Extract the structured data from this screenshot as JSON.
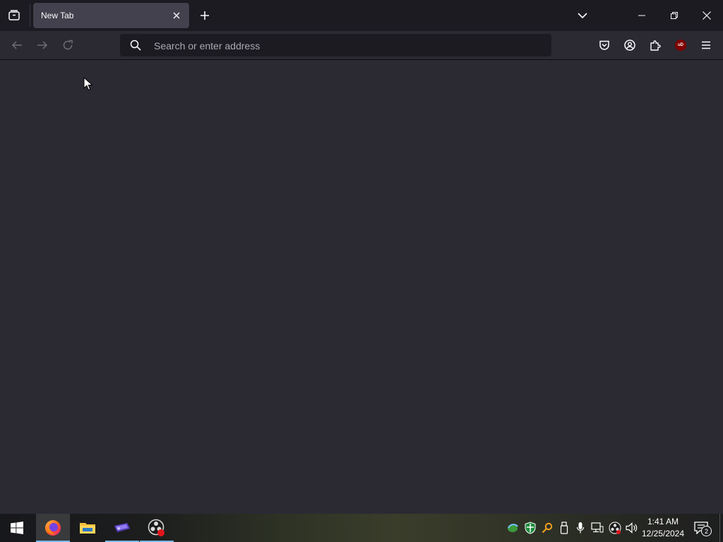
{
  "browser": {
    "tabs": [
      {
        "title": "New Tab",
        "active": true
      }
    ],
    "urlbar": {
      "placeholder": "Search or enter address",
      "value": ""
    },
    "icons": {
      "tab_list": "tab-list-icon",
      "tab_close": "close-icon",
      "new_tab": "plus-icon",
      "list_all_tabs": "chevron-down-icon",
      "back": "arrow-left-icon",
      "forward": "arrow-right-icon",
      "reload": "reload-icon",
      "search": "search-icon",
      "pocket": "pocket-icon",
      "account": "account-icon",
      "extensions": "puzzle-icon",
      "ublock": "ublock-origin-icon",
      "menu": "hamburger-menu-icon"
    },
    "ublock_badge": "uD"
  },
  "window_controls": [
    "minimize-icon",
    "restore-icon",
    "close-icon"
  ],
  "taskbar": {
    "apps": [
      {
        "name": "start",
        "icon": "windows-logo-icon",
        "active": false
      },
      {
        "name": "firefox",
        "icon": "firefox-icon",
        "active": true,
        "running": true
      },
      {
        "name": "file-explorer",
        "icon": "folder-icon",
        "active": false,
        "running": false
      },
      {
        "name": "app",
        "icon": "app-icon",
        "active": false,
        "running": true
      },
      {
        "name": "obs",
        "icon": "obs-icon",
        "active": false,
        "running": true
      }
    ],
    "tray_icons": [
      "network-share-icon",
      "security-shield-icon",
      "search-key-icon",
      "usb-drive-icon",
      "microphone-icon",
      "network-icon",
      "obs-tray-icon",
      "volume-icon"
    ],
    "clock": {
      "time": "1:41 AM",
      "date": "12/25/2024"
    },
    "notifications": {
      "count": "2"
    }
  },
  "colors": {
    "tabstrip_bg": "#1c1b22",
    "toolbar_bg": "#2b2a33",
    "active_tab_bg": "#42414d",
    "urlbar_bg": "#1c1b22",
    "content_bg": "#2b2a33",
    "ublock_red": "#800000",
    "taskbar_accent": "#76b9ed"
  }
}
